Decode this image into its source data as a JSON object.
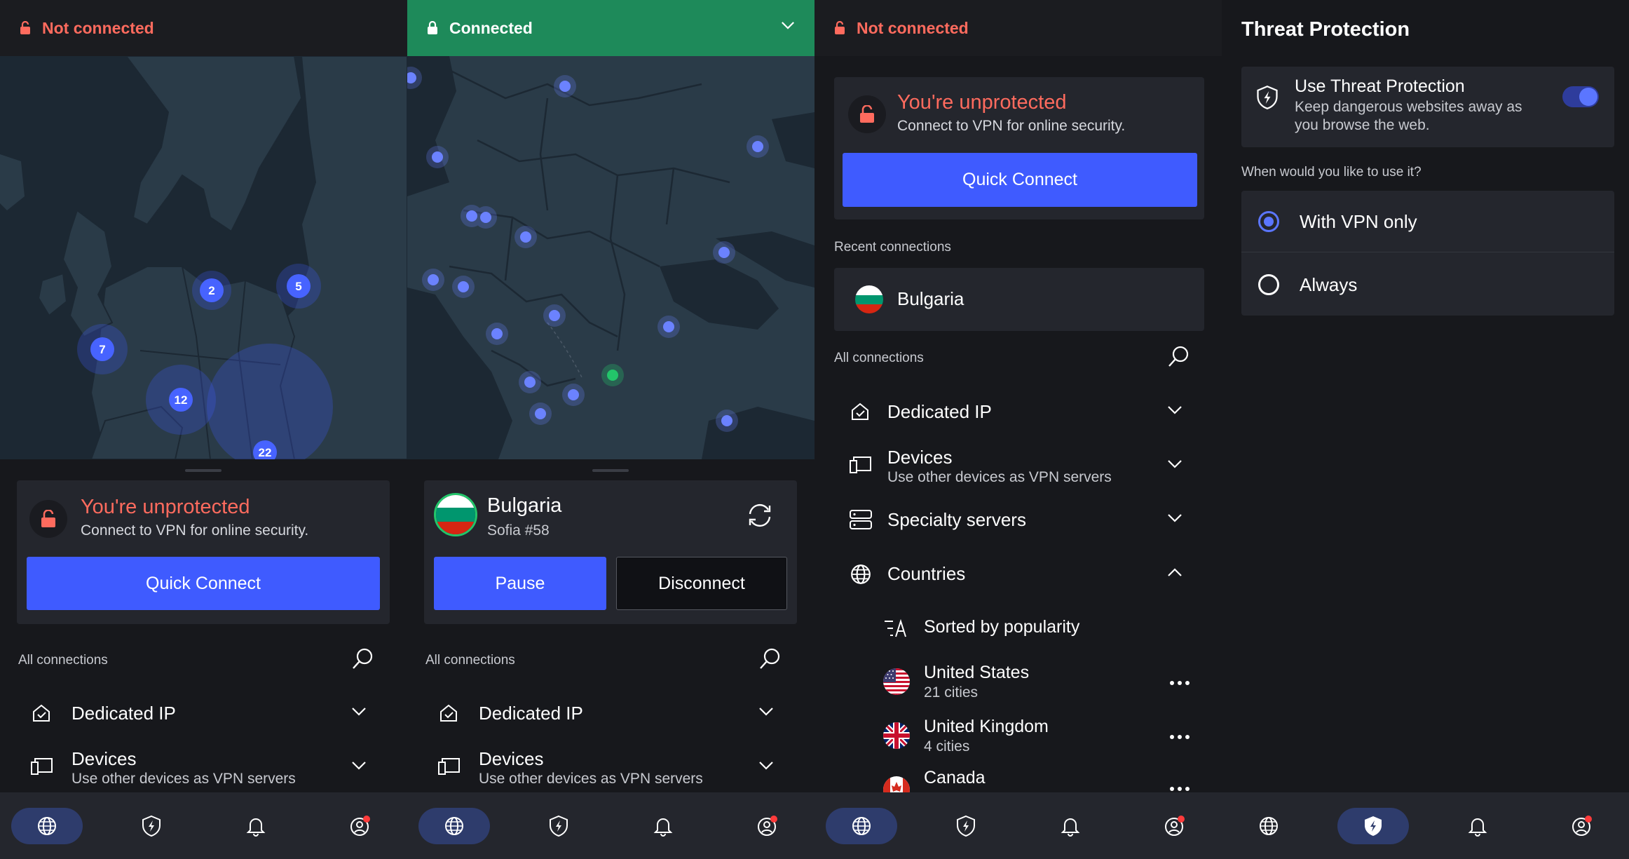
{
  "colors": {
    "accent": "#3f5bff",
    "danger": "#ff6b5e",
    "connected": "#1e8a5a",
    "map_sea": "#1a2530",
    "map_land": "#2a3b48",
    "server_dot": "#6b82ff"
  },
  "screen1": {
    "status": "Not connected",
    "map_clusters": [
      "2",
      "5",
      "7",
      "12",
      "22"
    ],
    "card": {
      "title": "You're unprotected",
      "subtitle": "Connect to VPN for online security.",
      "button": "Quick Connect"
    },
    "all_connections": "All connections",
    "rows": [
      {
        "title": "Dedicated IP",
        "icon": "dedicated-ip-icon"
      },
      {
        "title": "Devices",
        "subtitle": "Use other devices as VPN servers",
        "icon": "devices-icon"
      }
    ]
  },
  "screen2": {
    "status": "Connected",
    "card": {
      "country": "Bulgaria",
      "server": "Sofia #58",
      "pause": "Pause",
      "disconnect": "Disconnect"
    },
    "all_connections": "All connections",
    "rows": [
      {
        "title": "Dedicated IP",
        "icon": "dedicated-ip-icon"
      },
      {
        "title": "Devices",
        "subtitle": "Use other devices as VPN servers",
        "icon": "devices-icon"
      }
    ]
  },
  "screen3": {
    "status": "Not connected",
    "card": {
      "title": "You're unprotected",
      "subtitle": "Connect to VPN for online security.",
      "button": "Quick Connect"
    },
    "recent_label": "Recent connections",
    "recent": [
      {
        "name": "Bulgaria"
      }
    ],
    "all_connections": "All connections",
    "rows": [
      {
        "title": "Dedicated IP",
        "icon": "dedicated-ip-icon"
      },
      {
        "title": "Devices",
        "subtitle": "Use other devices as VPN servers",
        "icon": "devices-icon"
      },
      {
        "title": "Specialty servers",
        "icon": "specialty-servers-icon"
      },
      {
        "title": "Countries",
        "icon": "globe-icon"
      }
    ],
    "sort_label": "Sorted by popularity",
    "countries": [
      {
        "name": "United States",
        "cities": "21 cities"
      },
      {
        "name": "United Kingdom",
        "cities": "4 cities"
      },
      {
        "name": "Canada",
        "cities": ""
      }
    ]
  },
  "screen4": {
    "title": "Threat Protection",
    "toggle_title": "Use Threat Protection",
    "toggle_desc_1": "Keep dangerous websites away as",
    "toggle_desc_2": "you browse the web.",
    "toggle_on": true,
    "question": "When would you like to use it?",
    "options": [
      {
        "label": "With VPN only",
        "selected": true
      },
      {
        "label": "Always",
        "selected": false
      }
    ]
  },
  "tabs": [
    "globe-icon",
    "shield-bolt-icon",
    "bell-icon",
    "profile-icon"
  ]
}
